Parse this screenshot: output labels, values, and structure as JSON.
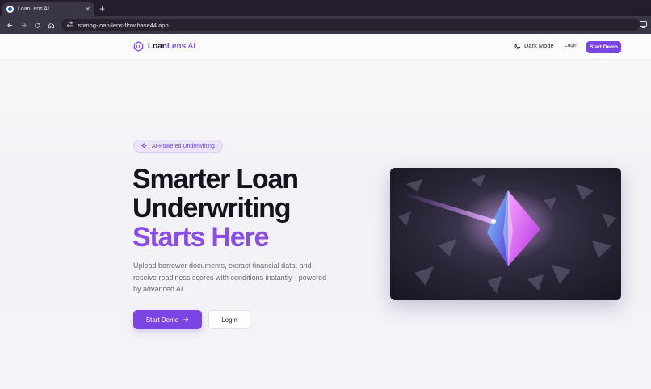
{
  "browser": {
    "tab_title": "LoanLens AI",
    "tab_close": "✕",
    "new_tab": "+",
    "url": "stirring-loan-lens-flow.base44.app"
  },
  "header": {
    "logo_part1": "Loan",
    "logo_part2": "Lens",
    "logo_part3": " AI",
    "dark_mode_label": "Dark Mode",
    "login_label": "Login",
    "start_demo_label": "Start Demo"
  },
  "hero": {
    "badge": "AI-Powered Underwriting",
    "title_line1": "Smarter Loan",
    "title_line2": "Underwriting",
    "title_line3": "Starts Here",
    "description": "Upload borrower documents, extract financial data, and receive readiness scores with conditions instantly - powered by advanced AI.",
    "start_demo_label": "Start Demo",
    "login_label": "Login"
  },
  "icons": {
    "logo": "shield-hexagon-icon",
    "moon": "moon-icon",
    "sparkle": "sparkle-icon",
    "arrow": "arrow-right-icon"
  },
  "colors": {
    "accent": "#7a45e2",
    "title_purple": "#8a4ee6",
    "text_dark": "#15131c"
  }
}
